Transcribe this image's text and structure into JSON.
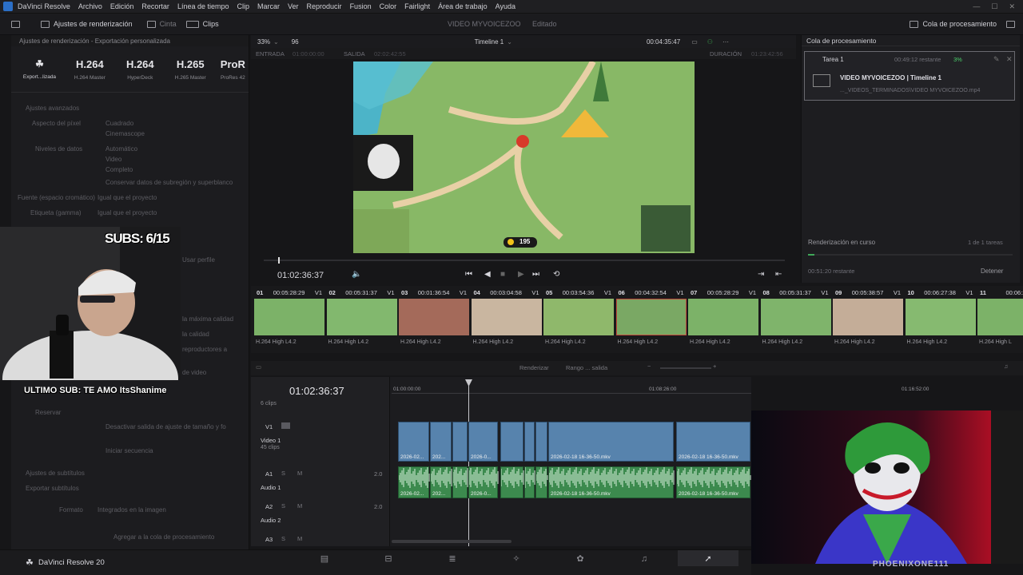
{
  "menubar": {
    "items": [
      "DaVinci Resolve",
      "Archivo",
      "Edición",
      "Recortar",
      "Línea de tiempo",
      "Clip",
      "Marcar",
      "Ver",
      "Reproducir",
      "Fusion",
      "Color",
      "Fairlight",
      "Área de trabajo",
      "Ayuda"
    ]
  },
  "toolbar": {
    "render_settings": "Ajustes de renderización",
    "tape": "Cinta",
    "clips": "Clips",
    "project_title": "VIDEO MYVOICEZOO",
    "edited": "Editado",
    "render_queue": "Cola de procesamiento"
  },
  "left_panel": {
    "header": "Ajustes de renderización - Exportación personalizada",
    "presets": [
      {
        "big": "",
        "small": "Export...lizada",
        "icon": "custom-export-icon"
      },
      {
        "big": "H.264",
        "small": "H.264 Master"
      },
      {
        "big": "H.264",
        "small": "HyperDeck"
      },
      {
        "big": "H.265",
        "small": "H.265 Master"
      },
      {
        "big": "ProR",
        "small": "ProRes 42"
      }
    ],
    "rows": [
      "Ajustes avanzados",
      "Aspecto del píxel",
      "Cuadrado",
      "Cinemascope",
      "Niveles de datos",
      "Automático",
      "Video",
      "Completo",
      "Conservar datos de subregión y superblanco",
      "Fuente (espacio cromático)",
      "Igual que el proyecto",
      "Etiqueta (gamma)",
      "Igual que el proyecto",
      "Usar perfile",
      "la máxima calidad",
      "la calidad",
      "reproductores a",
      "de video",
      "Reservar",
      "Desactivar salida de ajuste de tamaño y fo",
      "Iniciar secuencia",
      "Ajustes de subtítulos",
      "Exportar subtítulos",
      "Formato",
      "Integrados en la imagen",
      "Agregar a la cola de procesamiento"
    ]
  },
  "overlay": {
    "subs": "SUBS: 6/15",
    "last_sub": "ULTIMO SUB: TE AMO ItsShanime",
    "watermark": "PHOENIXONE111"
  },
  "viewer": {
    "zoom": "33%",
    "fps": "96",
    "timeline_name": "Timeline 1",
    "duration_tc": "00:04:35:47",
    "entrada": "ENTRADA",
    "entrada_tc": "01:00:00:00",
    "salida": "SALIDA",
    "salida_tc": "02:02:42:55",
    "duracion": "DURACIÓN",
    "duracion_tc": "01:23:42:56",
    "current_tc": "01:02:36:37",
    "coins": "195"
  },
  "render_queue": {
    "title": "Cola de procesamiento",
    "job": "Tarea 1",
    "job_time": "00:49:12 restante",
    "job_percent": "3%",
    "job_name": "VIDEO MYVOICEZOO | Timeline 1",
    "job_path": "..._VIDEOS_TERMINADOS\\VIDEO MYVOICEZOO.mp4",
    "status": "Renderización en curso",
    "count": "1 de 1 tareas",
    "remaining": "00:51:20 restante",
    "stop": "Detener",
    "progress": 0.03
  },
  "clips": [
    {
      "n": "01",
      "tc": "00:05:28:29",
      "v": "V1",
      "codec": "H.264 High L4.2",
      "color": "#7cb268"
    },
    {
      "n": "02",
      "tc": "00:05:31:37",
      "v": "V1",
      "codec": "H.264 High L4.2",
      "color": "#82b86e"
    },
    {
      "n": "03",
      "tc": "00:01:36:54",
      "v": "V1",
      "codec": "H.264 High L4.2",
      "color": "#a46a5a"
    },
    {
      "n": "04",
      "tc": "00:03:04:58",
      "v": "V1",
      "codec": "H.264 High L4.2",
      "color": "#c9b6a0"
    },
    {
      "n": "05",
      "tc": "00:03:54:36",
      "v": "V1",
      "codec": "H.264 High L4.2",
      "color": "#8fb86b"
    },
    {
      "n": "06",
      "tc": "00:04:32:54",
      "v": "V1",
      "codec": "H.264 High L4.2",
      "color": "#7aa864"
    },
    {
      "n": "07",
      "tc": "00:05:28:29",
      "v": "V1",
      "codec": "H.264 High L4.2",
      "color": "#7cb268"
    },
    {
      "n": "08",
      "tc": "00:05:31:37",
      "v": "V1",
      "codec": "H.264 High L4.2",
      "color": "#7fb46b"
    },
    {
      "n": "09",
      "tc": "00:05:38:57",
      "v": "V1",
      "codec": "H.264 High L4.2",
      "color": "#c4ad98"
    },
    {
      "n": "10",
      "tc": "00:06:27:38",
      "v": "V1",
      "codec": "H.264 High L4.2",
      "color": "#86ba70"
    },
    {
      "n": "11",
      "tc": "00:06:2",
      "v": "",
      "codec": "H.264 High L",
      "color": "#7cb268"
    }
  ],
  "timeline": {
    "controls": [
      "Renderizar",
      "Rango ... salida"
    ],
    "current_tc": "01:02:36:37",
    "ruler": [
      "01:00:00:00",
      "01:08:26:00",
      "01:16:52:00"
    ],
    "tracks": [
      {
        "id": "V1",
        "name": "Video 1",
        "sub": "45 clips"
      },
      {
        "id": "A1",
        "name": "Audio 1",
        "level": "2.0"
      },
      {
        "id": "A2",
        "name": "Audio 2",
        "level": "2.0"
      },
      {
        "id": "A3",
        "name": "",
        "level": ""
      }
    ],
    "above": "6 clips",
    "clip_labels": [
      "2026-02...",
      "202...",
      "2026-0...",
      "2026-02-18 16-36-50.mkv",
      "2026-02-18 16-36-50.mkv"
    ]
  },
  "bottombar": {
    "brand": "DaVinci Resolve 20"
  }
}
